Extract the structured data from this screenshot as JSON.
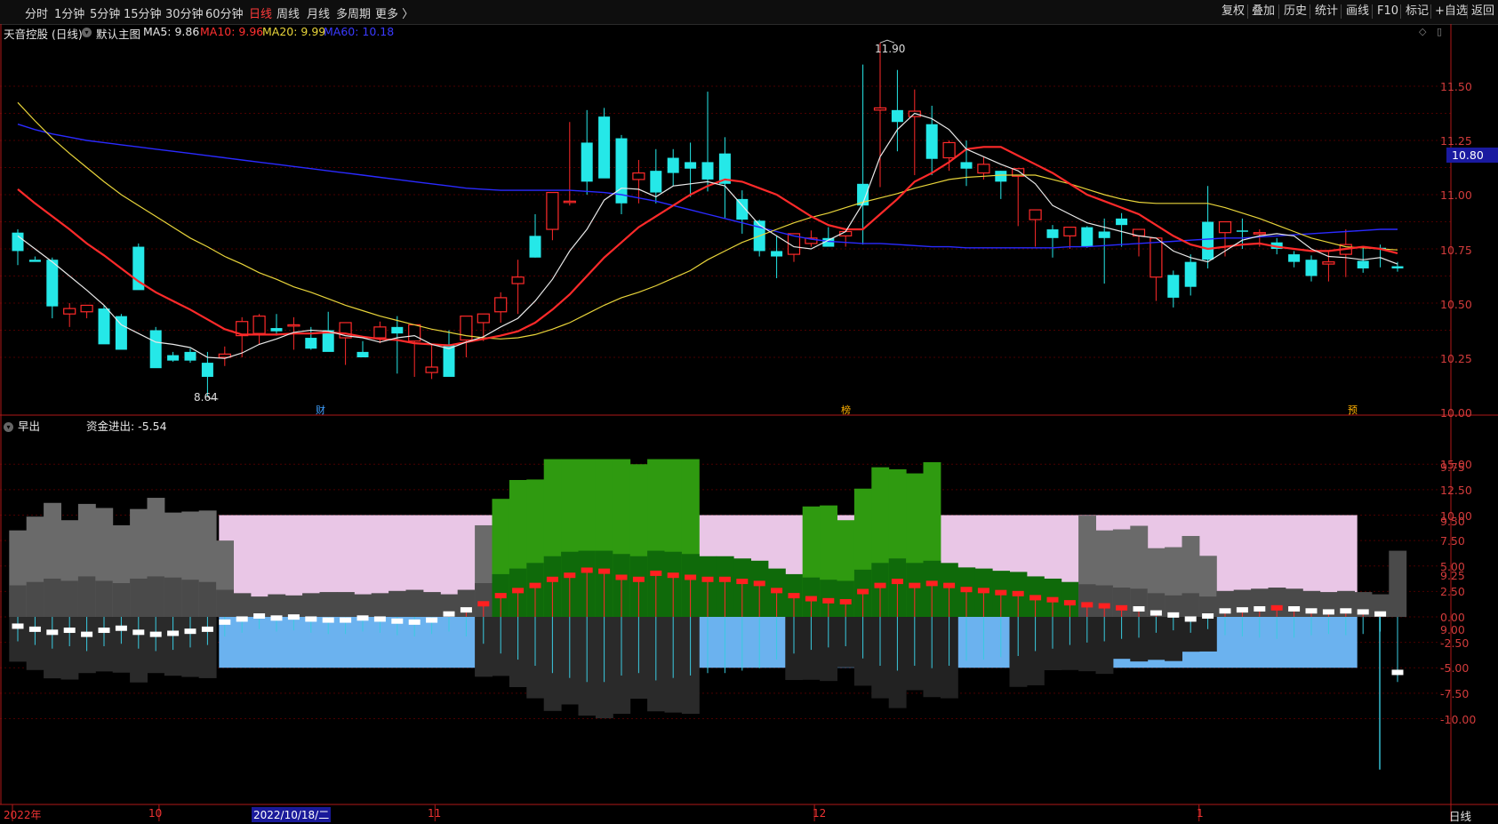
{
  "toolbar": {
    "periods": [
      "分时",
      "1分钟",
      "5分钟",
      "15分钟",
      "30分钟",
      "60分钟",
      "日线",
      "周线",
      "月线",
      "多周期",
      "更多 〉"
    ],
    "active_period": "日线",
    "right_buttons": [
      "复权",
      "叠加",
      "历史",
      "统计",
      "画线",
      "F10",
      "标记",
      "+自选",
      "返回"
    ]
  },
  "stock": {
    "title": "天音控股 (日线)",
    "indicator_name": "默认主图",
    "ma5": "MA5: 9.86",
    "ma10": "MA10: 9.96",
    "ma20": "MA20: 9.99",
    "ma60": "MA60: 10.18",
    "high_label": "11.90",
    "low_label": "8.64",
    "current_price": "10.80"
  },
  "colors": {
    "ma5": "#e8e8e8",
    "ma10": "#ff2a2a",
    "ma20": "#e8d43a",
    "ma60": "#2a2aff",
    "up": "#ff2a2a",
    "down": "#25e8e8",
    "axis": "#d23b3b"
  },
  "event_markers": [
    {
      "index": 19,
      "text": "财"
    },
    {
      "index": 49,
      "text": "榜"
    },
    {
      "index": 79,
      "text": "预"
    }
  ],
  "price_axis": [
    "11.50",
    "11.25",
    "11.00",
    "10.75",
    "10.50",
    "10.25",
    "10.00",
    "9.75",
    "9.50",
    "9.25",
    "9.00"
  ],
  "sub_indicator": {
    "name": "早出",
    "value_label": "资金进出: -5.54",
    "axis": [
      "15.00",
      "12.50",
      "10.00",
      "7.50",
      "5.00",
      "2.50",
      "0.00",
      "-2.50",
      "-5.00",
      "-7.50",
      "-10.00"
    ]
  },
  "date_axis": {
    "labels": [
      {
        "text": "2022年",
        "index": 0
      },
      {
        "text": "10",
        "index": 8.5
      },
      {
        "text": "11",
        "index": 24.5
      },
      {
        "text": "12",
        "index": 46.5
      },
      {
        "text": "1",
        "index": 68.8
      }
    ],
    "cursor_date": "2022/10/18/二",
    "right_label": "日线"
  },
  "chart_data": {
    "type": "candlestick",
    "open": [
      10.15,
      9.9,
      9.9,
      9.4,
      9.42,
      9.45,
      9.38,
      10.02,
      9.25,
      9.02,
      9.05,
      8.95,
      9.0,
      9.2,
      9.22,
      9.27,
      9.3,
      9.18,
      9.25,
      9.18,
      9.05,
      9.18,
      9.28,
      9.15,
      8.86,
      9.12,
      9.16,
      9.32,
      9.42,
      9.68,
      10.12,
      10.18,
      10.44,
      10.98,
      11.22,
      11.02,
      10.64,
      10.72,
      10.84,
      10.8,
      10.8,
      10.88,
      10.46,
      10.26,
      9.98,
      9.95,
      10.05,
      10.1,
      10.12,
      10.6,
      11.28,
      11.28,
      11.22,
      11.15,
      10.84,
      10.8,
      10.7,
      10.72,
      10.67,
      10.27,
      10.18,
      10.12,
      10.2,
      10.16,
      10.28,
      10.12,
      9.74,
      9.76,
      9.88,
      10.25,
      10.15,
      10.17,
      10.15,
      10.06,
      9.95,
      9.9,
      9.86,
      9.95,
      9.89,
      10.01,
      9.84
    ],
    "high": [
      10.18,
      9.93,
      9.92,
      9.5,
      9.47,
      9.48,
      9.4,
      10.05,
      9.28,
      9.05,
      9.08,
      9.05,
      9.1,
      9.37,
      9.4,
      9.4,
      9.37,
      9.28,
      9.42,
      9.28,
      9.15,
      9.33,
      9.38,
      9.3,
      9.12,
      9.25,
      9.2,
      9.35,
      9.6,
      9.9,
      10.32,
      10.52,
      11.17,
      11.28,
      11.3,
      11.05,
      10.82,
      10.92,
      10.92,
      10.98,
      11.45,
      11.03,
      10.54,
      10.27,
      10.12,
      10.1,
      10.17,
      10.2,
      10.18,
      11.7,
      11.9,
      11.65,
      11.47,
      11.32,
      11.0,
      11.0,
      10.85,
      10.72,
      10.69,
      10.35,
      10.22,
      10.15,
      10.21,
      10.28,
      10.33,
      10.14,
      9.82,
      9.8,
      9.95,
      10.58,
      10.23,
      10.28,
      10.18,
      10.1,
      9.98,
      9.94,
      9.98,
      10.18,
      10.02,
      10.04,
      9.88
    ],
    "low": [
      9.85,
      9.9,
      9.36,
      9.28,
      9.36,
      9.35,
      9.22,
      9.73,
      8.92,
      8.96,
      8.95,
      8.64,
      8.92,
      9.0,
      9.12,
      9.2,
      9.07,
      9.07,
      9.15,
      8.93,
      9.0,
      9.13,
      8.85,
      8.82,
      8.8,
      8.96,
      9.0,
      9.15,
      9.32,
      9.4,
      9.92,
      10.08,
      10.4,
      10.5,
      10.88,
      10.32,
      10.42,
      10.42,
      10.58,
      10.48,
      10.53,
      10.28,
      10.14,
      9.93,
      9.73,
      9.88,
      10.02,
      10.04,
      10.02,
      10.04,
      10.57,
      10.9,
      10.68,
      10.68,
      10.72,
      10.58,
      10.64,
      10.46,
      10.21,
      10.02,
      9.92,
      10.0,
      10.01,
      9.68,
      10.02,
      9.93,
      9.52,
      9.46,
      9.57,
      9.82,
      9.93,
      10.0,
      10.02,
      9.95,
      9.83,
      9.7,
      9.7,
      9.74,
      9.78,
      9.83,
      9.79
    ],
    "close": [
      9.98,
      9.88,
      9.47,
      9.45,
      9.48,
      9.12,
      9.07,
      9.62,
      8.9,
      8.97,
      8.97,
      8.82,
      9.03,
      9.33,
      9.38,
      9.24,
      9.3,
      9.08,
      9.05,
      9.32,
      9.0,
      9.28,
      9.22,
      9.3,
      8.91,
      8.82,
      9.38,
      9.4,
      9.55,
      9.74,
      9.92,
      10.52,
      10.44,
      10.62,
      10.65,
      10.42,
      10.7,
      10.52,
      10.7,
      10.74,
      10.64,
      10.6,
      10.27,
      9.98,
      9.93,
      10.14,
      10.1,
      10.02,
      10.16,
      10.4,
      11.3,
      11.17,
      11.27,
      10.83,
      10.98,
      10.74,
      10.78,
      10.62,
      10.74,
      10.36,
      10.1,
      10.2,
      10.02,
      10.1,
      10.22,
      10.18,
      10.1,
      9.55,
      9.65,
      9.9,
      10.25,
      10.16,
      10.15,
      10.0,
      9.88,
      9.75,
      9.88,
      10.04,
      9.82,
      10.0,
      9.82
    ],
    "ma5": [
      10.12,
      10.0,
      9.88,
      9.75,
      9.62,
      9.48,
      9.3,
      9.22,
      9.14,
      9.12,
      9.09,
      9.0,
      8.99,
      9.04,
      9.12,
      9.17,
      9.23,
      9.25,
      9.24,
      9.2,
      9.18,
      9.14,
      9.18,
      9.2,
      9.12,
      9.08,
      9.14,
      9.19,
      9.28,
      9.36,
      9.52,
      9.72,
      9.98,
      10.18,
      10.45,
      10.56,
      10.55,
      10.48,
      10.58,
      10.6,
      10.62,
      10.58,
      10.4,
      10.22,
      10.12,
      10.02,
      10.0,
      10.08,
      10.16,
      10.42,
      10.85,
      11.1,
      11.25,
      11.2,
      11.1,
      10.92,
      10.85,
      10.78,
      10.72,
      10.6,
      10.4,
      10.32,
      10.24,
      10.2,
      10.16,
      10.12,
      10.1,
      9.98,
      9.92,
      9.88,
      9.98,
      10.08,
      10.12,
      10.14,
      10.12,
      10.0,
      9.93,
      9.92,
      9.9,
      9.92,
      9.86
    ],
    "ma10": [
      10.55,
      10.42,
      10.3,
      10.18,
      10.05,
      9.94,
      9.82,
      9.7,
      9.6,
      9.52,
      9.44,
      9.35,
      9.26,
      9.21,
      9.21,
      9.21,
      9.22,
      9.22,
      9.23,
      9.22,
      9.19,
      9.17,
      9.16,
      9.13,
      9.12,
      9.11,
      9.14,
      9.17,
      9.2,
      9.24,
      9.32,
      9.44,
      9.58,
      9.75,
      9.92,
      10.06,
      10.2,
      10.3,
      10.4,
      10.5,
      10.58,
      10.64,
      10.62,
      10.56,
      10.5,
      10.4,
      10.3,
      10.22,
      10.18,
      10.18,
      10.32,
      10.46,
      10.62,
      10.7,
      10.8,
      10.92,
      10.94,
      10.94,
      10.86,
      10.78,
      10.7,
      10.6,
      10.5,
      10.44,
      10.38,
      10.32,
      10.22,
      10.12,
      10.04,
      10.0,
      10.02,
      10.04,
      10.05,
      10.02,
      10.0,
      9.98,
      9.98,
      10.0,
      10.02,
      10.0,
      9.96
    ],
    "ma20": [
      11.35,
      11.18,
      11.02,
      10.88,
      10.75,
      10.62,
      10.5,
      10.4,
      10.3,
      10.2,
      10.1,
      10.02,
      9.93,
      9.86,
      9.78,
      9.72,
      9.65,
      9.6,
      9.54,
      9.48,
      9.43,
      9.38,
      9.34,
      9.3,
      9.26,
      9.23,
      9.2,
      9.18,
      9.17,
      9.18,
      9.21,
      9.26,
      9.32,
      9.4,
      9.48,
      9.55,
      9.6,
      9.66,
      9.73,
      9.8,
      9.9,
      9.98,
      10.06,
      10.12,
      10.18,
      10.24,
      10.29,
      10.33,
      10.38,
      10.43,
      10.47,
      10.51,
      10.56,
      10.6,
      10.64,
      10.66,
      10.67,
      10.68,
      10.68,
      10.68,
      10.64,
      10.6,
      10.55,
      10.5,
      10.46,
      10.43,
      10.42,
      10.42,
      10.42,
      10.42,
      10.38,
      10.33,
      10.28,
      10.22,
      10.16,
      10.1,
      10.06,
      10.02,
      10.01,
      10.0,
      9.99
    ],
    "ma60": [
      11.15,
      11.1,
      11.06,
      11.03,
      11.0,
      10.98,
      10.96,
      10.94,
      10.92,
      10.9,
      10.88,
      10.86,
      10.84,
      10.82,
      10.8,
      10.78,
      10.76,
      10.74,
      10.72,
      10.7,
      10.68,
      10.66,
      10.64,
      10.62,
      10.6,
      10.58,
      10.56,
      10.55,
      10.54,
      10.54,
      10.54,
      10.54,
      10.54,
      10.53,
      10.52,
      10.5,
      10.47,
      10.44,
      10.4,
      10.36,
      10.32,
      10.28,
      10.24,
      10.2,
      10.16,
      10.12,
      10.09,
      10.07,
      10.06,
      10.05,
      10.05,
      10.04,
      10.03,
      10.02,
      10.02,
      10.01,
      10.01,
      10.01,
      10.01,
      10.01,
      10.01,
      10.02,
      10.02,
      10.03,
      10.04,
      10.05,
      10.06,
      10.07,
      10.08,
      10.09,
      10.1,
      10.1,
      10.11,
      10.12,
      10.13,
      10.14,
      10.15,
      10.16,
      10.17,
      10.18,
      10.18
    ],
    "fund_flow": [
      -1.0,
      -1.3,
      -1.6,
      -1.4,
      -1.8,
      -1.4,
      -1.2,
      -1.6,
      -1.8,
      -1.7,
      -1.5,
      -1.3,
      -0.6,
      -0.3,
      0.0,
      -0.2,
      -0.1,
      -0.3,
      -0.4,
      -0.4,
      -0.2,
      -0.3,
      -0.5,
      -0.6,
      -0.4,
      0.2,
      0.6,
      1.2,
      2.0,
      2.5,
      3.0,
      3.6,
      4.0,
      4.5,
      4.4,
      3.8,
      3.6,
      4.2,
      4.0,
      3.8,
      3.6,
      3.6,
      3.4,
      3.2,
      2.5,
      2.0,
      1.7,
      1.5,
      1.4,
      2.4,
      3.0,
      3.4,
      3.0,
      3.2,
      3.0,
      2.6,
      2.5,
      2.3,
      2.2,
      1.8,
      1.6,
      1.3,
      1.1,
      1.0,
      0.8,
      0.7,
      0.3,
      0.1,
      -0.3,
      0.0,
      0.5,
      0.6,
      0.7,
      0.8,
      0.7,
      0.5,
      0.4,
      0.5,
      0.4,
      0.2,
      -5.54
    ],
    "xlabel": "",
    "ylabel": ""
  }
}
